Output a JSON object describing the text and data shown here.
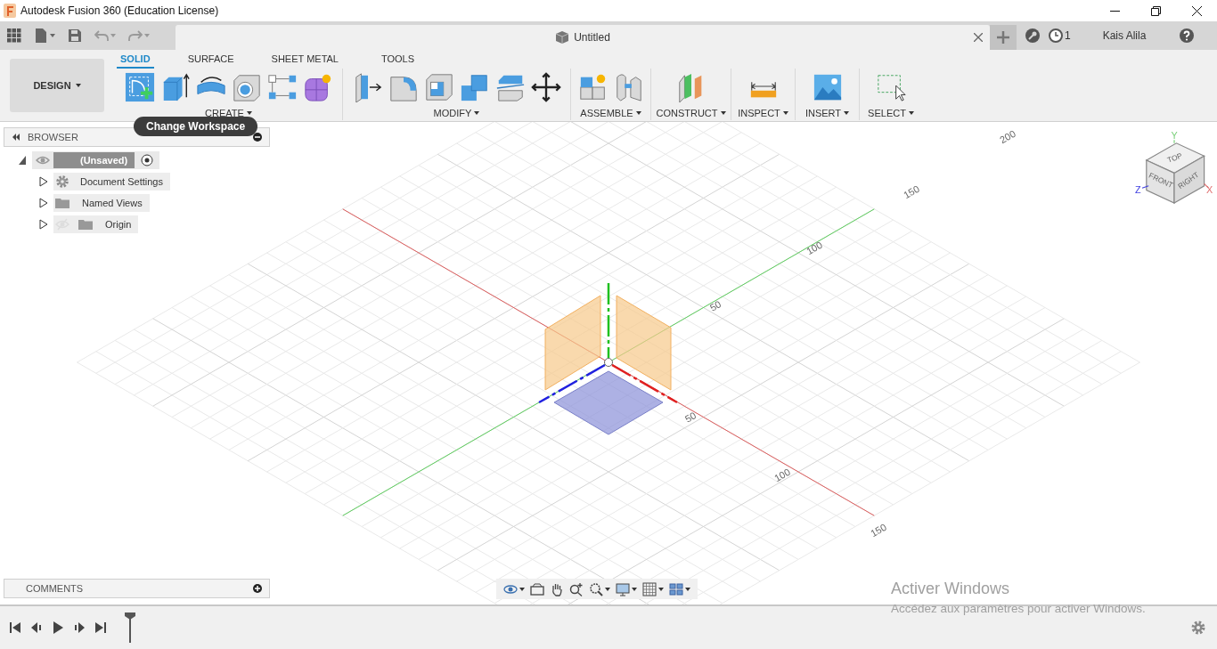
{
  "window": {
    "title": "Autodesk Fusion 360 (Education License)"
  },
  "document_tab": {
    "title": "Untitled"
  },
  "job_count": "1",
  "user": "Kais Alila",
  "workspace": {
    "label": "DESIGN"
  },
  "toolbar_tabs": [
    {
      "label": "SOLID",
      "selected": true
    },
    {
      "label": "SURFACE",
      "selected": false
    },
    {
      "label": "SHEET METAL",
      "selected": false
    },
    {
      "label": "TOOLS",
      "selected": false
    }
  ],
  "tool_groups": [
    {
      "label": "CREATE"
    },
    {
      "label": "MODIFY"
    },
    {
      "label": "ASSEMBLE"
    },
    {
      "label": "CONSTRUCT"
    },
    {
      "label": "INSPECT"
    },
    {
      "label": "INSERT"
    },
    {
      "label": "SELECT"
    }
  ],
  "tooltip": "Change Workspace",
  "browser": {
    "title": "BROWSER",
    "tree": [
      {
        "label": "(Unsaved)",
        "kind": "component",
        "expanded": true,
        "visible": true,
        "children": [
          {
            "label": "Document Settings",
            "kind": "settings",
            "expanded": false
          },
          {
            "label": "Named Views",
            "kind": "folder",
            "expanded": false
          },
          {
            "label": "Origin",
            "kind": "folder",
            "expanded": false,
            "visible": false
          }
        ]
      }
    ]
  },
  "comments": {
    "title": "COMMENTS"
  },
  "viewport": {
    "axis_labels": [
      {
        "text": "200"
      },
      {
        "text": "150"
      },
      {
        "text": "100"
      },
      {
        "text": "50"
      },
      {
        "text": "50"
      },
      {
        "text": "100"
      },
      {
        "text": "150"
      }
    ]
  },
  "view_cube": {
    "faces": [
      "TOP",
      "FRONT",
      "RIGHT"
    ],
    "axes": [
      "Y",
      "Z",
      "X"
    ]
  },
  "activation_notice": {
    "title": "Activer Windows",
    "message": "Accédez aux paramètres pour activer Windows."
  }
}
